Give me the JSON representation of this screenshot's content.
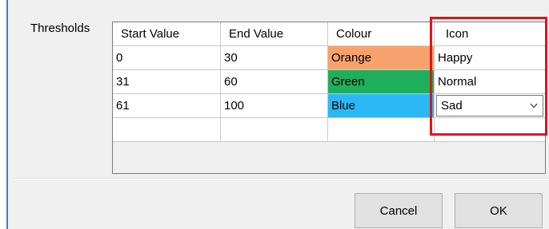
{
  "thresholds_label": "Thresholds",
  "grid": {
    "headers": [
      "Start Value",
      "End Value",
      "Colour",
      "Icon"
    ],
    "rows": [
      {
        "start": "0",
        "end": "30",
        "colour": "Orange",
        "colour_hex": "#f7a26d",
        "icon": "Happy"
      },
      {
        "start": "31",
        "end": "60",
        "colour": "Green",
        "colour_hex": "#1fae5b",
        "icon": "Normal"
      },
      {
        "start": "61",
        "end": "100",
        "colour": "Blue",
        "colour_hex": "#2ab9f4",
        "icon": "Sad"
      }
    ]
  },
  "buttons": {
    "cancel": "Cancel",
    "ok": "OK"
  },
  "highlight_color": "#e1141b"
}
